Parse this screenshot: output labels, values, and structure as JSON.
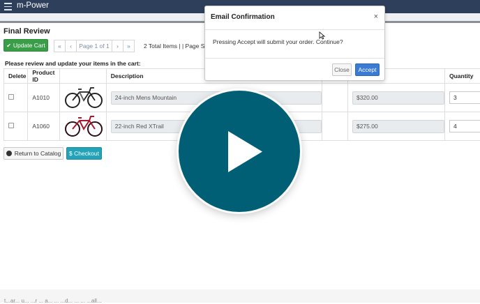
{
  "app": {
    "title": "m-Power"
  },
  "page": {
    "title": "Final Review"
  },
  "toolbar": {
    "update_cart_label": "Update Cart",
    "update_cart_icon": "check-icon",
    "pager": {
      "first": "«",
      "prev": "‹",
      "page_label": "Page 1 of 1",
      "next": "›",
      "last": "»"
    },
    "info": "2 Total Items | | Page Size"
  },
  "instruction": "Please review and update your items in the cart:",
  "table": {
    "columns": [
      "Delete",
      "Product ID",
      "",
      "Description",
      "",
      "",
      "Quantity"
    ],
    "rows": [
      {
        "product_id": "A1010",
        "description": "24-inch Mens Mountain",
        "price": "$320.00",
        "quantity": "3",
        "image": "bike-black-icon"
      },
      {
        "product_id": "A1060",
        "description": "22-inch Red XTrail",
        "price": "$275.00",
        "quantity": "4",
        "image": "bike-red-icon"
      }
    ]
  },
  "actions": {
    "return_label": "Return to Catalog",
    "checkout_label": "$ Checkout"
  },
  "modal": {
    "title": "Email Confirmation",
    "close_glyph": "×",
    "body": "Pressing Accept will submit your order. Continue?",
    "close_label": "Close",
    "accept_label": "Accept"
  },
  "overlay": {
    "icon": "play-icon",
    "color": "#005e75"
  },
  "footer": {
    "text": "t...ar... u... ...r ... a... ... ...d... ... ... ...all..."
  },
  "colors": {
    "header": "#2e3f5c",
    "update_green": "#3a9e48",
    "checkout_teal": "#23a3b8",
    "accept_blue": "#3a7bd5"
  }
}
